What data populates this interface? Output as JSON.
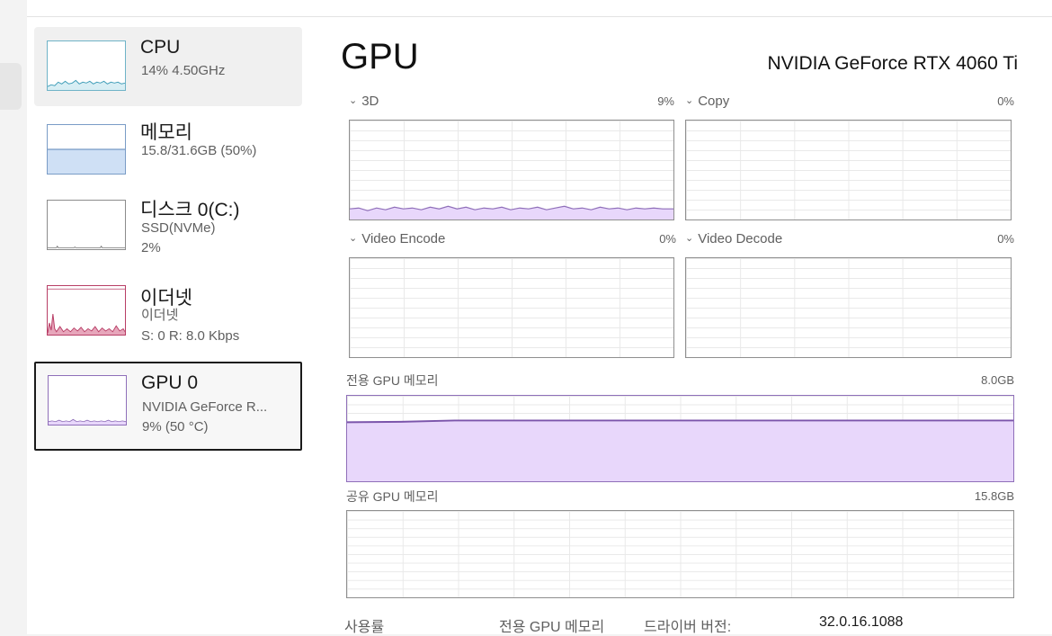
{
  "sidebar": {
    "items": [
      {
        "title": "CPU",
        "line1": "14% 4.50GHz",
        "line2": ""
      },
      {
        "title": "메모리",
        "line1": "15.8/31.6GB (50%)",
        "line2": ""
      },
      {
        "title": "디스크 0(C:)",
        "line1": "SSD(NVMe)",
        "line2": "2%"
      },
      {
        "title": "이더넷",
        "line1": "이더넷",
        "line2": "S: 0 R: 8.0 Kbps"
      },
      {
        "title": "GPU 0",
        "line1": "NVIDIA GeForce R...",
        "line2": "9% (50 °C)"
      }
    ]
  },
  "main": {
    "title": "GPU",
    "device_name": "NVIDIA GeForce RTX 4060 Ti",
    "engines": [
      {
        "label": "3D",
        "percent": "9%"
      },
      {
        "label": "Copy",
        "percent": "0%"
      },
      {
        "label": "Video Encode",
        "percent": "0%"
      },
      {
        "label": "Video Decode",
        "percent": "0%"
      }
    ],
    "dedicated_memory": {
      "label": "전용 GPU 메모리",
      "max": "8.0GB"
    },
    "shared_memory": {
      "label": "공유 GPU 메모리",
      "max": "15.8GB"
    },
    "footer": {
      "utilization_label": "사용률",
      "dedicated_label": "전용 GPU 메모리",
      "driver_label": "드라이버 버전:",
      "driver_value": "32.0.16.1088"
    }
  },
  "colors": {
    "gpu": "#8f6fb9",
    "gpu_fill": "#e8d7fb",
    "cpu": "#6fb3c7",
    "memory": "#7a9cc6",
    "ethernet": "#b83e66"
  },
  "icons": {
    "engine_collapse": "chevron-down-icon"
  }
}
